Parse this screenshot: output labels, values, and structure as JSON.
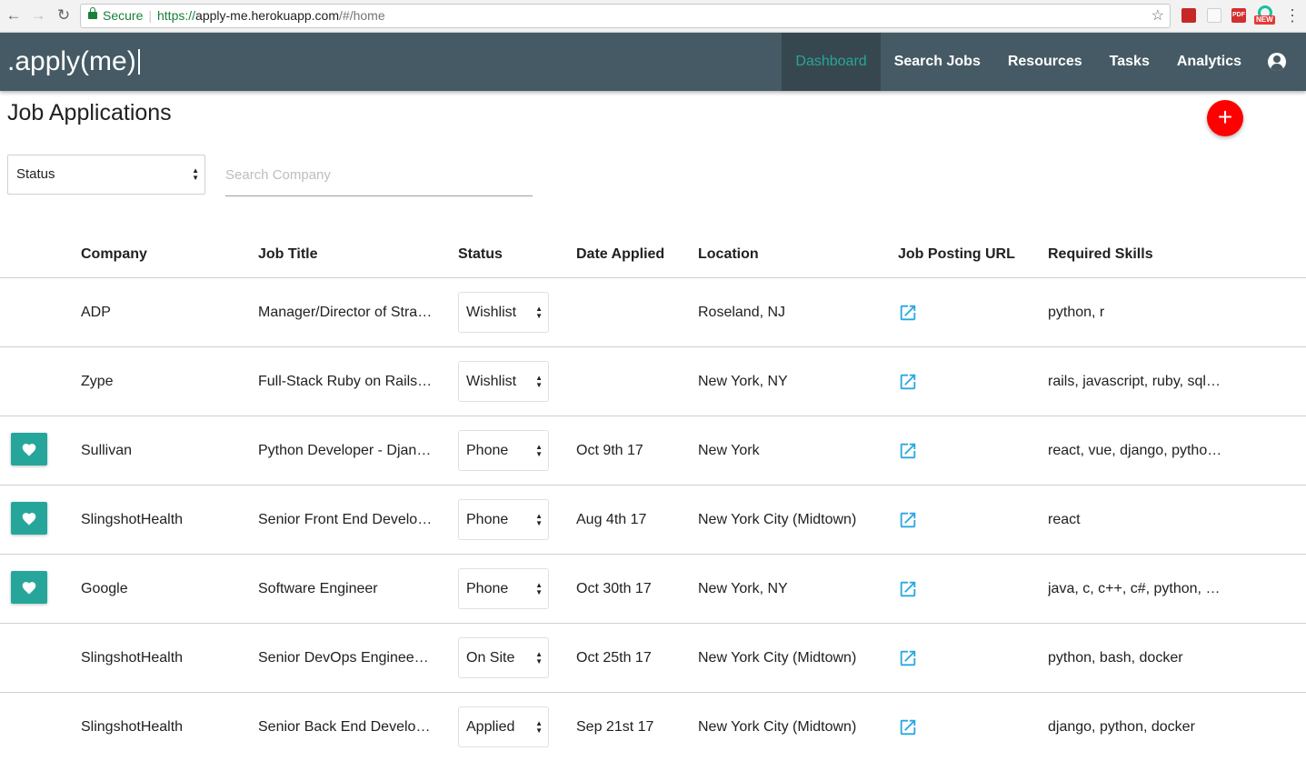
{
  "browser": {
    "secure_label": "Secure",
    "url_scheme": "https://",
    "url_host": "apply-me.herokuapp.com",
    "url_path": "/#/home",
    "pdf_ext_label": "PDF",
    "new_badge": "NEW"
  },
  "appbar": {
    "brand": ".apply(me)",
    "nav": [
      "Dashboard",
      "Search Jobs",
      "Resources",
      "Tasks",
      "Analytics"
    ],
    "active_nav": "Dashboard"
  },
  "page": {
    "title": "Job Applications",
    "add_label": "+",
    "status_filter": "Status",
    "search_placeholder": "Search Company"
  },
  "table": {
    "headers": {
      "company": "Company",
      "title": "Job Title",
      "status": "Status",
      "date": "Date Applied",
      "location": "Location",
      "url": "Job Posting URL",
      "skills": "Required Skills"
    },
    "rows": [
      {
        "favorite": false,
        "company": "ADP",
        "title": "Manager/Director of Strategy",
        "status": "Wishlist",
        "date": "",
        "location": "Roseland, NJ",
        "skills": "python, r"
      },
      {
        "favorite": false,
        "company": "Zype",
        "title": "Full-Stack Ruby on Rails Developer",
        "status": "Wishlist",
        "date": "",
        "location": "New York, NY",
        "skills": "rails, javascript, ruby, sql, react"
      },
      {
        "favorite": true,
        "company": "Sullivan",
        "title": "Python Developer - Django",
        "status": "Phone",
        "date": "Oct 9th 17",
        "location": "New York",
        "skills": "react, vue, django, python, postgres"
      },
      {
        "favorite": true,
        "company": "SlingshotHealth",
        "title": "Senior Front End Developer",
        "status": "Phone",
        "date": "Aug 4th 17",
        "location": "New York City (Midtown)",
        "skills": "react"
      },
      {
        "favorite": true,
        "company": "Google",
        "title": "Software Engineer",
        "status": "Phone",
        "date": "Oct 30th 17",
        "location": "New York, NY",
        "skills": "java, c, c++, c#, python, javascript"
      },
      {
        "favorite": false,
        "company": "SlingshotHealth",
        "title": "Senior DevOps Engineer (AWS)",
        "status": "On Site",
        "date": "Oct 25th 17",
        "location": "New York City (Midtown)",
        "skills": "python, bash, docker"
      },
      {
        "favorite": false,
        "company": "SlingshotHealth",
        "title": "Senior Back End Developer",
        "status": "Applied",
        "date": "Sep 21st 17",
        "location": "New York City (Midtown)",
        "skills": "django, python, docker"
      }
    ]
  },
  "colors": {
    "appbar": "#455a64",
    "active_nav_bg": "#37474f",
    "accent_teal": "#26a69a",
    "fab_red": "#ff0000",
    "link_blue": "#29a8e0"
  }
}
